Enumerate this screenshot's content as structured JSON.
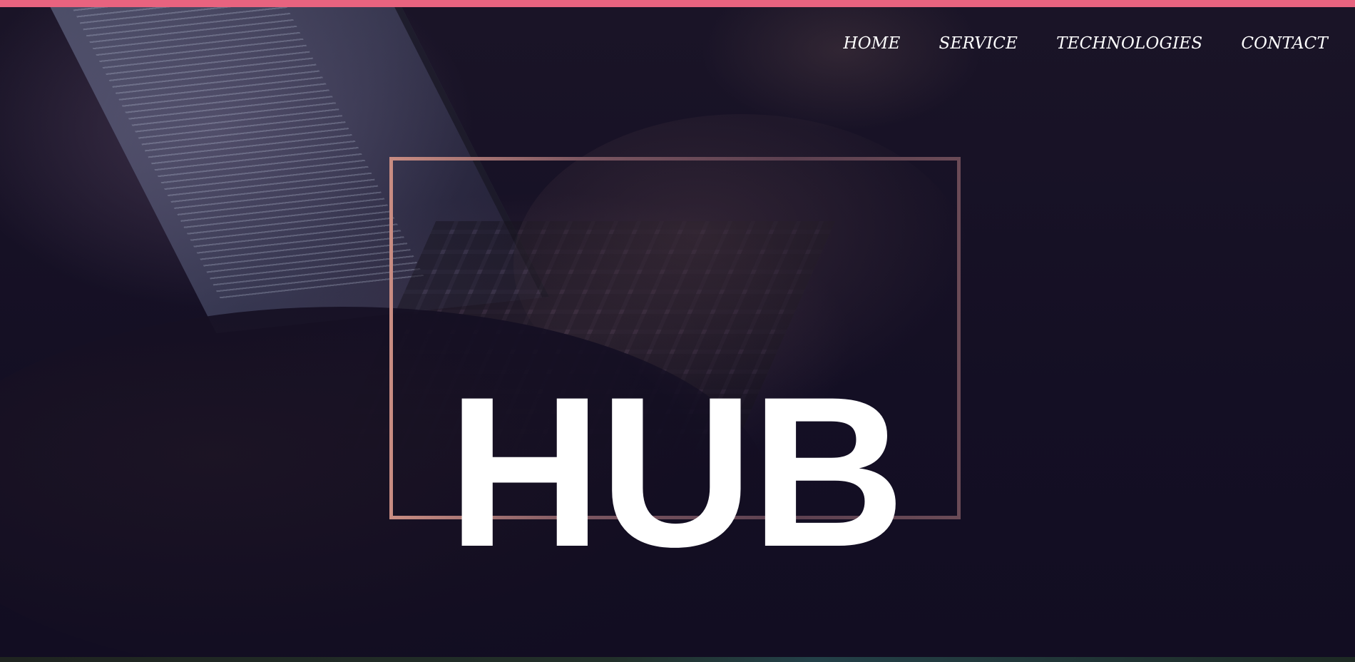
{
  "colors": {
    "accent_bar": "#e8637f",
    "hero_background": "#130e22",
    "frame_border": "#a9737a",
    "text": "#ffffff"
  },
  "nav": {
    "items": [
      {
        "label": "HOME"
      },
      {
        "label": "SERVICE"
      },
      {
        "label": "TECHNOLOGIES"
      },
      {
        "label": "CONTACT"
      }
    ]
  },
  "hero": {
    "title": "HUB"
  }
}
